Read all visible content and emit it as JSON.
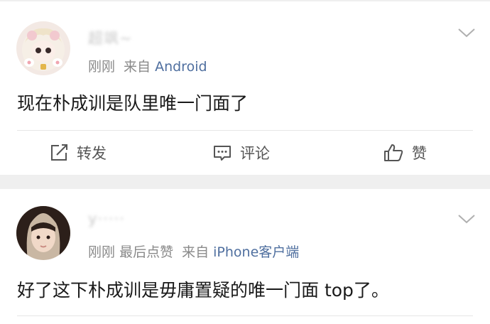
{
  "posts": [
    {
      "username": "超飒~",
      "time": "刚刚",
      "source_prefix": "来自",
      "source": "Android",
      "text": "现在朴成训是队里唯一门面了",
      "actions": {
        "repost": "转发",
        "comment": "评论",
        "like": "赞"
      }
    },
    {
      "username": "y·····",
      "time": "刚刚",
      "liked_note": "最后点赞",
      "source_prefix": "来自",
      "source": "iPhone客户端",
      "text": "好了这下朴成训是毋庸置疑的唯一门面 top了。"
    }
  ],
  "colors": {
    "source_link": "#4f6f9f",
    "meta_text": "#8a8a8a",
    "body_text": "#1a1a1a",
    "page_bg": "#efefef"
  },
  "icons": [
    "chevron-down-icon",
    "repost-icon",
    "comment-icon",
    "like-icon"
  ]
}
